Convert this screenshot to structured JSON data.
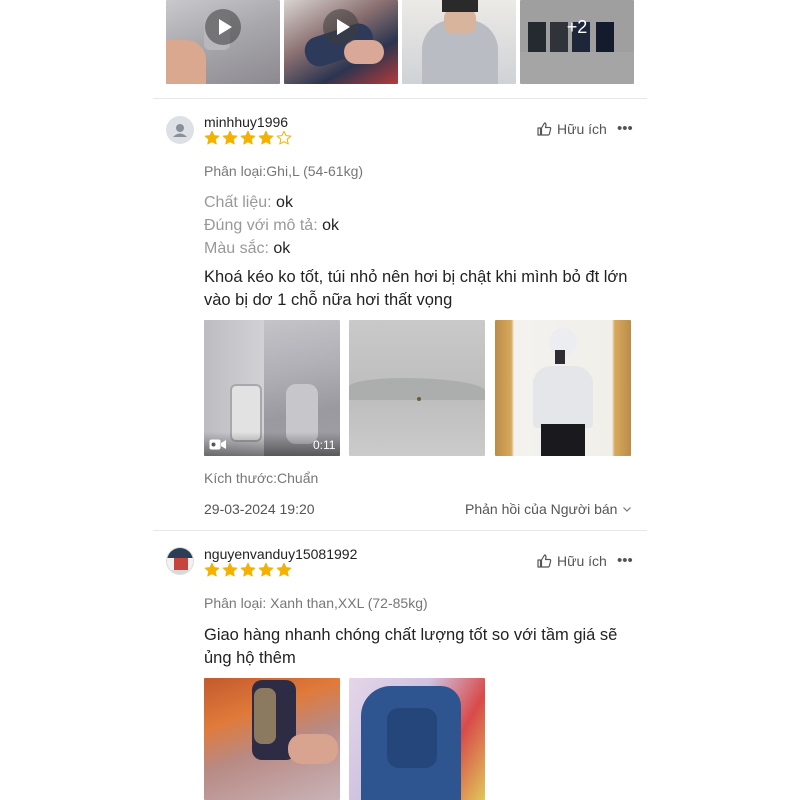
{
  "top_gallery": {
    "more_count": "+2"
  },
  "reviews": [
    {
      "username": "minhhuy1996",
      "rating": 4,
      "max_rating": 5,
      "helpful_label": "Hữu ích",
      "more_label": "•••",
      "variation_label": "Phân loại:",
      "variation_value": "Ghi,L (54-61kg)",
      "attributes": [
        {
          "label": "Chất liệu:",
          "value": "ok"
        },
        {
          "label": "Đúng với mô tả:",
          "value": "ok"
        },
        {
          "label": "Màu sắc:",
          "value": "ok"
        }
      ],
      "content_line1": "Khoá kéo ko tốt, túi nhỏ nên hơi bị chật khi mình bỏ đt lớn",
      "content_line2": "vào bị dơ 1 chỗ nữa hơi thất vọng",
      "video_duration": "0:11",
      "size_label": "Kích thước:",
      "size_value": "Chuẩn",
      "date": "29-03-2024 19:20",
      "seller_reply_label": "Phản hồi của Người bán"
    },
    {
      "username": "nguyenvanduy15081992",
      "rating": 5,
      "max_rating": 5,
      "helpful_label": "Hữu ích",
      "more_label": "•••",
      "variation_label": "Phân loại:",
      "variation_value": "Xanh than,XXL (72-85kg)",
      "content_line1": "Giao hàng nhanh chóng chất lượng tốt so với tầm giá sẽ",
      "content_line2": "ủng hộ thêm"
    }
  ],
  "colors": {
    "star": "#f5b100",
    "star_empty": "#f5b100",
    "divider": "#e8e8e8"
  }
}
